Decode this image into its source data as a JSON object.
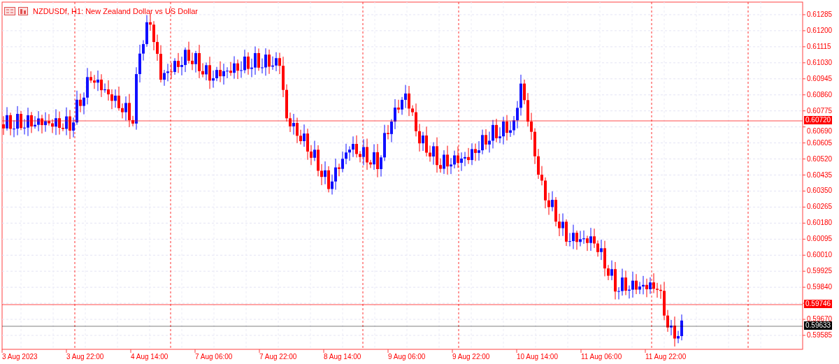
{
  "title": "NZDUSDf, H1:  New Zealand Dollar vs US Dollar",
  "price_axis": [
    "0.61285",
    "0.61200",
    "0.61115",
    "0.61030",
    "0.60945",
    "0.60860",
    "0.60775",
    "0.60690",
    "0.60605",
    "0.60520",
    "0.60435",
    "0.60350",
    "0.60265",
    "0.60180",
    "0.60095",
    "0.60010",
    "0.59925",
    "0.59840",
    "0.59670",
    "0.59585"
  ],
  "time_axis": [
    "3 Aug 2023",
    "3 Aug 22:00",
    "4 Aug 14:00",
    "7 Aug 06:00",
    "7 Aug 22:00",
    "8 Aug 14:00",
    "9 Aug 06:00",
    "9 Aug 22:00",
    "10 Aug 14:00",
    "11 Aug 06:00",
    "11 Aug 22:00"
  ],
  "price_lines": [
    {
      "label": "0.60720",
      "color": "#ff0000"
    },
    {
      "label": "0.59746",
      "color": "#ff0000"
    },
    {
      "label": "0.59633",
      "color": "#000000"
    }
  ]
}
